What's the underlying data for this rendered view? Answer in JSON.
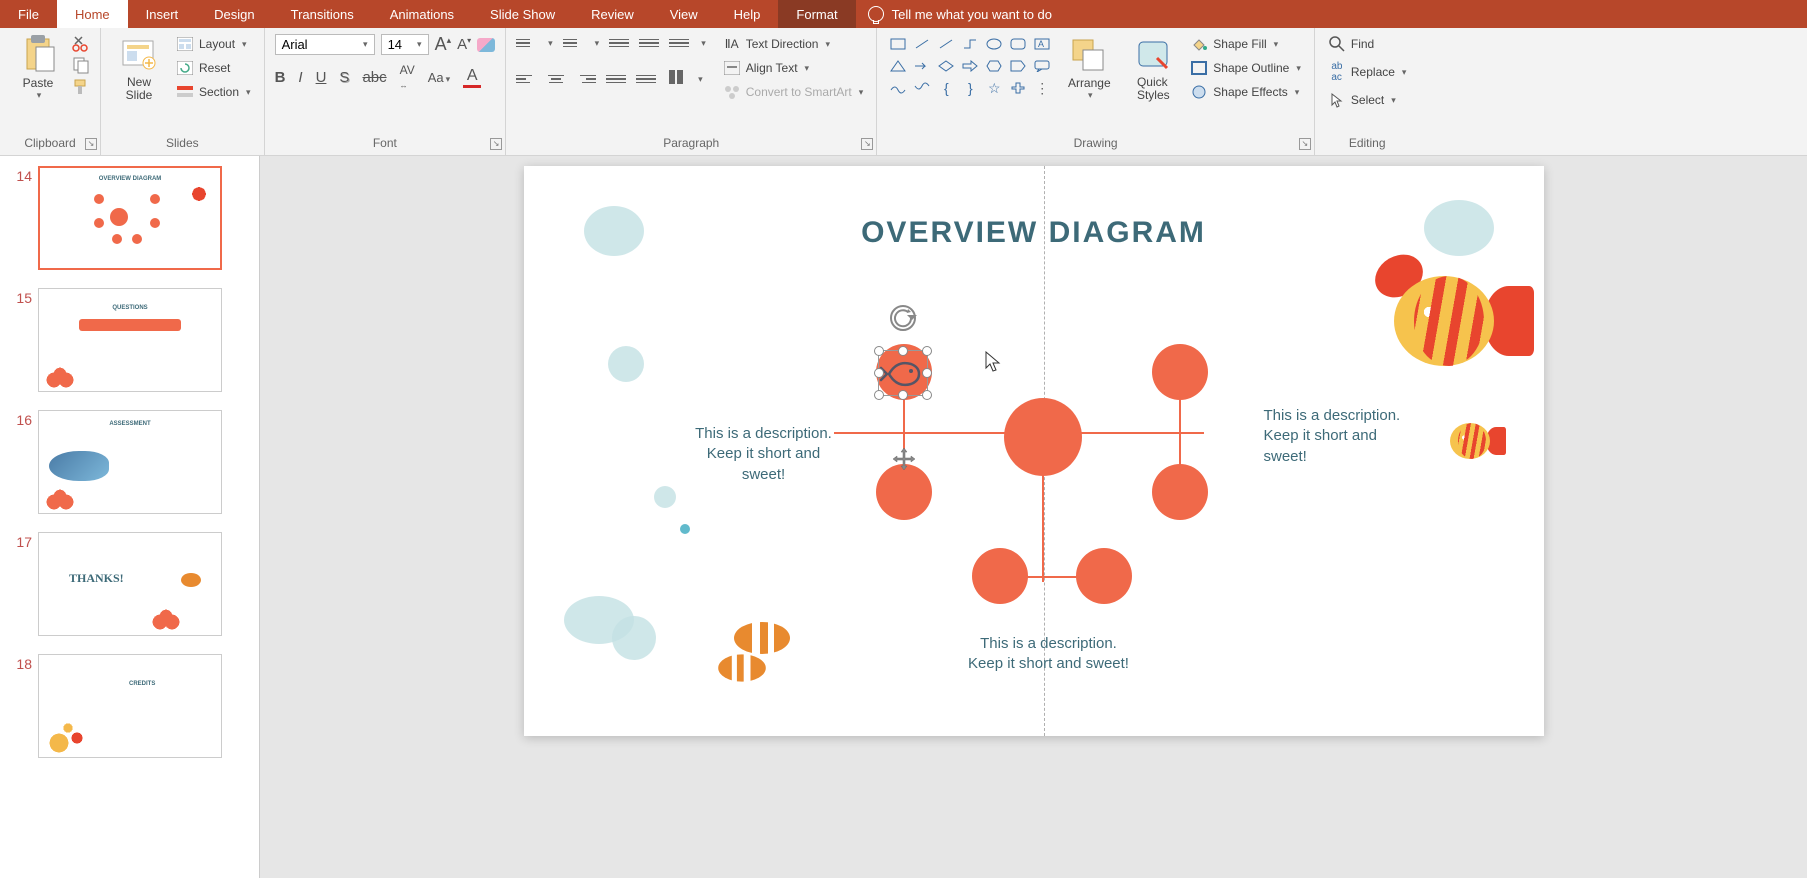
{
  "tabs": {
    "file": "File",
    "home": "Home",
    "insert": "Insert",
    "design": "Design",
    "transitions": "Transitions",
    "animations": "Animations",
    "slideshow": "Slide Show",
    "review": "Review",
    "view": "View",
    "help": "Help",
    "format": "Format",
    "tellme": "Tell me what you want to do"
  },
  "ribbon": {
    "clipboard": {
      "label": "Clipboard",
      "paste": "Paste"
    },
    "slides": {
      "label": "Slides",
      "newslide": "New\nSlide",
      "layout": "Layout",
      "reset": "Reset",
      "section": "Section"
    },
    "font": {
      "label": "Font",
      "name": "Arial",
      "size": "14"
    },
    "paragraph": {
      "label": "Paragraph",
      "textdir": "Text Direction",
      "align": "Align Text",
      "smartart": "Convert to SmartArt"
    },
    "drawing": {
      "label": "Drawing",
      "arrange": "Arrange",
      "quick": "Quick\nStyles",
      "fill": "Shape Fill",
      "outline": "Shape Outline",
      "effects": "Shape Effects"
    },
    "editing": {
      "label": "Editing",
      "find": "Find",
      "replace": "Replace",
      "select": "Select"
    }
  },
  "thumbnails": [
    {
      "num": "14",
      "title": "OVERVIEW DIAGRAM"
    },
    {
      "num": "15",
      "title": "QUESTIONS"
    },
    {
      "num": "16",
      "title": "ASSESSMENT"
    },
    {
      "num": "17",
      "title": "THANKS!"
    },
    {
      "num": "18",
      "title": "CREDITS"
    }
  ],
  "slide": {
    "title": "OVERVIEW DIAGRAM",
    "desc1": "This is a description. Keep it short and sweet!",
    "desc2": "This is a description. Keep it short and sweet!",
    "desc3": "This is a description. Keep it short and sweet!"
  }
}
